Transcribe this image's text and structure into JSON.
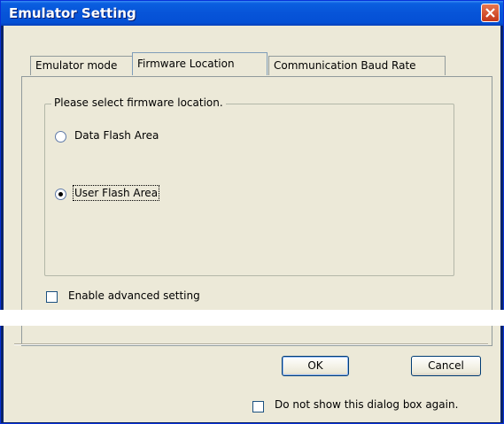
{
  "window": {
    "title": "Emulator Setting"
  },
  "tabs": [
    {
      "label": "Emulator mode"
    },
    {
      "label": "Firmware Location"
    },
    {
      "label": "Communication Baud Rate"
    }
  ],
  "firmware_location": {
    "group_label": "Please select firmware location.",
    "options": [
      {
        "label": "Data Flash Area",
        "selected": false
      },
      {
        "label": "User Flash Area",
        "selected": true
      }
    ],
    "advanced_setting_label": "Enable advanced setting",
    "advanced_setting_checked": false
  },
  "buttons": {
    "ok_label": "OK",
    "cancel_label": "Cancel"
  },
  "footer": {
    "dont_show_label": "Do not show this dialog box again.",
    "dont_show_checked": false
  }
}
